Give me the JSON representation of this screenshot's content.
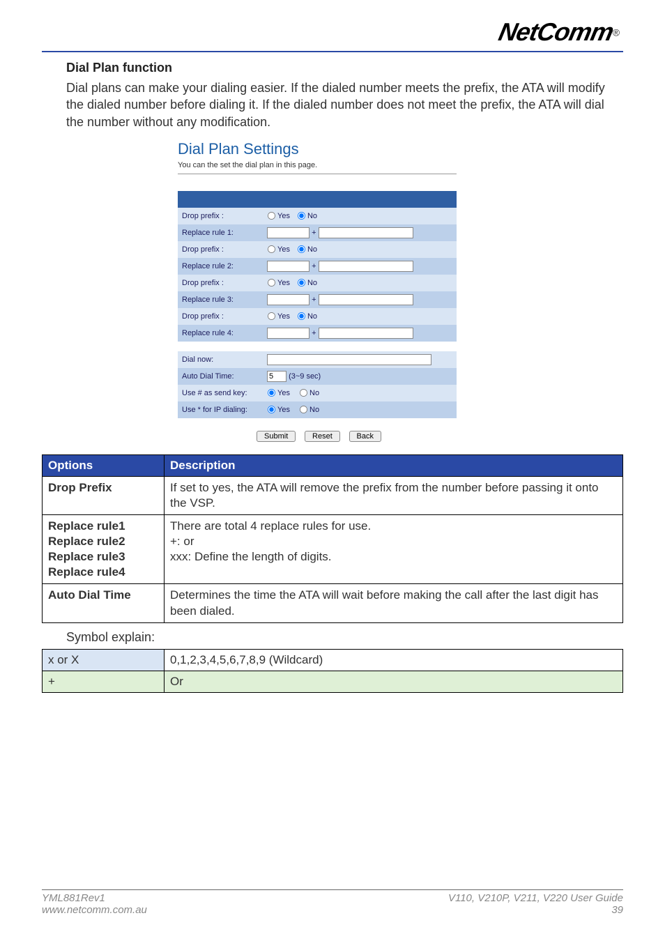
{
  "brand": "NetComm",
  "brand_reg": "®",
  "section_title": "Dial Plan function",
  "intro": "Dial plans can make your dialing easier. If the dialed number meets the prefix, the ATA will modify the dialed number before dialing it. If the dialed number does not meet the prefix, the ATA will dial the number without any modification.",
  "panel": {
    "title": "Dial Plan Settings",
    "subtitle": "You can the set the dial plan in this page.",
    "yes": "Yes",
    "no": "No",
    "rows": [
      {
        "label": "Drop prefix :",
        "type": "radio",
        "sel": "no"
      },
      {
        "label": "Replace rule 1:",
        "type": "rule"
      },
      {
        "label": "Drop prefix :",
        "type": "radio",
        "sel": "no"
      },
      {
        "label": "Replace rule 2:",
        "type": "rule"
      },
      {
        "label": "Drop prefix :",
        "type": "radio",
        "sel": "no"
      },
      {
        "label": "Replace rule 3:",
        "type": "rule"
      },
      {
        "label": "Drop prefix :",
        "type": "radio",
        "sel": "no"
      },
      {
        "label": "Replace rule 4:",
        "type": "rule"
      }
    ],
    "dial_now_label": "Dial now:",
    "auto_dial_label": "Auto Dial Time:",
    "auto_dial_value": "5",
    "auto_dial_hint": "(3~9 sec)",
    "hash_label": "Use # as send key:",
    "hash_sel": "yes",
    "star_label": "Use * for IP dialing:",
    "star_sel": "yes",
    "buttons": {
      "submit": "Submit",
      "reset": "Reset",
      "back": "Back"
    }
  },
  "desc_table": {
    "head_opt": "Options",
    "head_desc": "Description",
    "rows": [
      {
        "opt": "Drop Prefix",
        "desc": "If set to yes, the ATA will remove the prefix from the number before passing it onto the VSP."
      },
      {
        "opt": "Replace rule1\nReplace rule2\nReplace rule3\nReplace rule4",
        "desc": "There are total 4 replace rules for use.\n+: or\nxxx: Define the length of digits."
      },
      {
        "opt": "Auto Dial Time",
        "desc": "Determines the time the ATA will wait before making the call after the last digit has been dialed."
      }
    ]
  },
  "symbol_explain": "Symbol explain:",
  "sym_table": {
    "rows": [
      {
        "s1": "x or X",
        "s2": "0,1,2,3,4,5,6,7,8,9 (Wildcard)"
      },
      {
        "s1": "+",
        "s2": "Or"
      }
    ]
  },
  "footer": {
    "left1": "YML881Rev1",
    "left2": "www.netcomm.com.au",
    "right1": "V110, V210P, V211, V220 User Guide",
    "right2": "39"
  }
}
